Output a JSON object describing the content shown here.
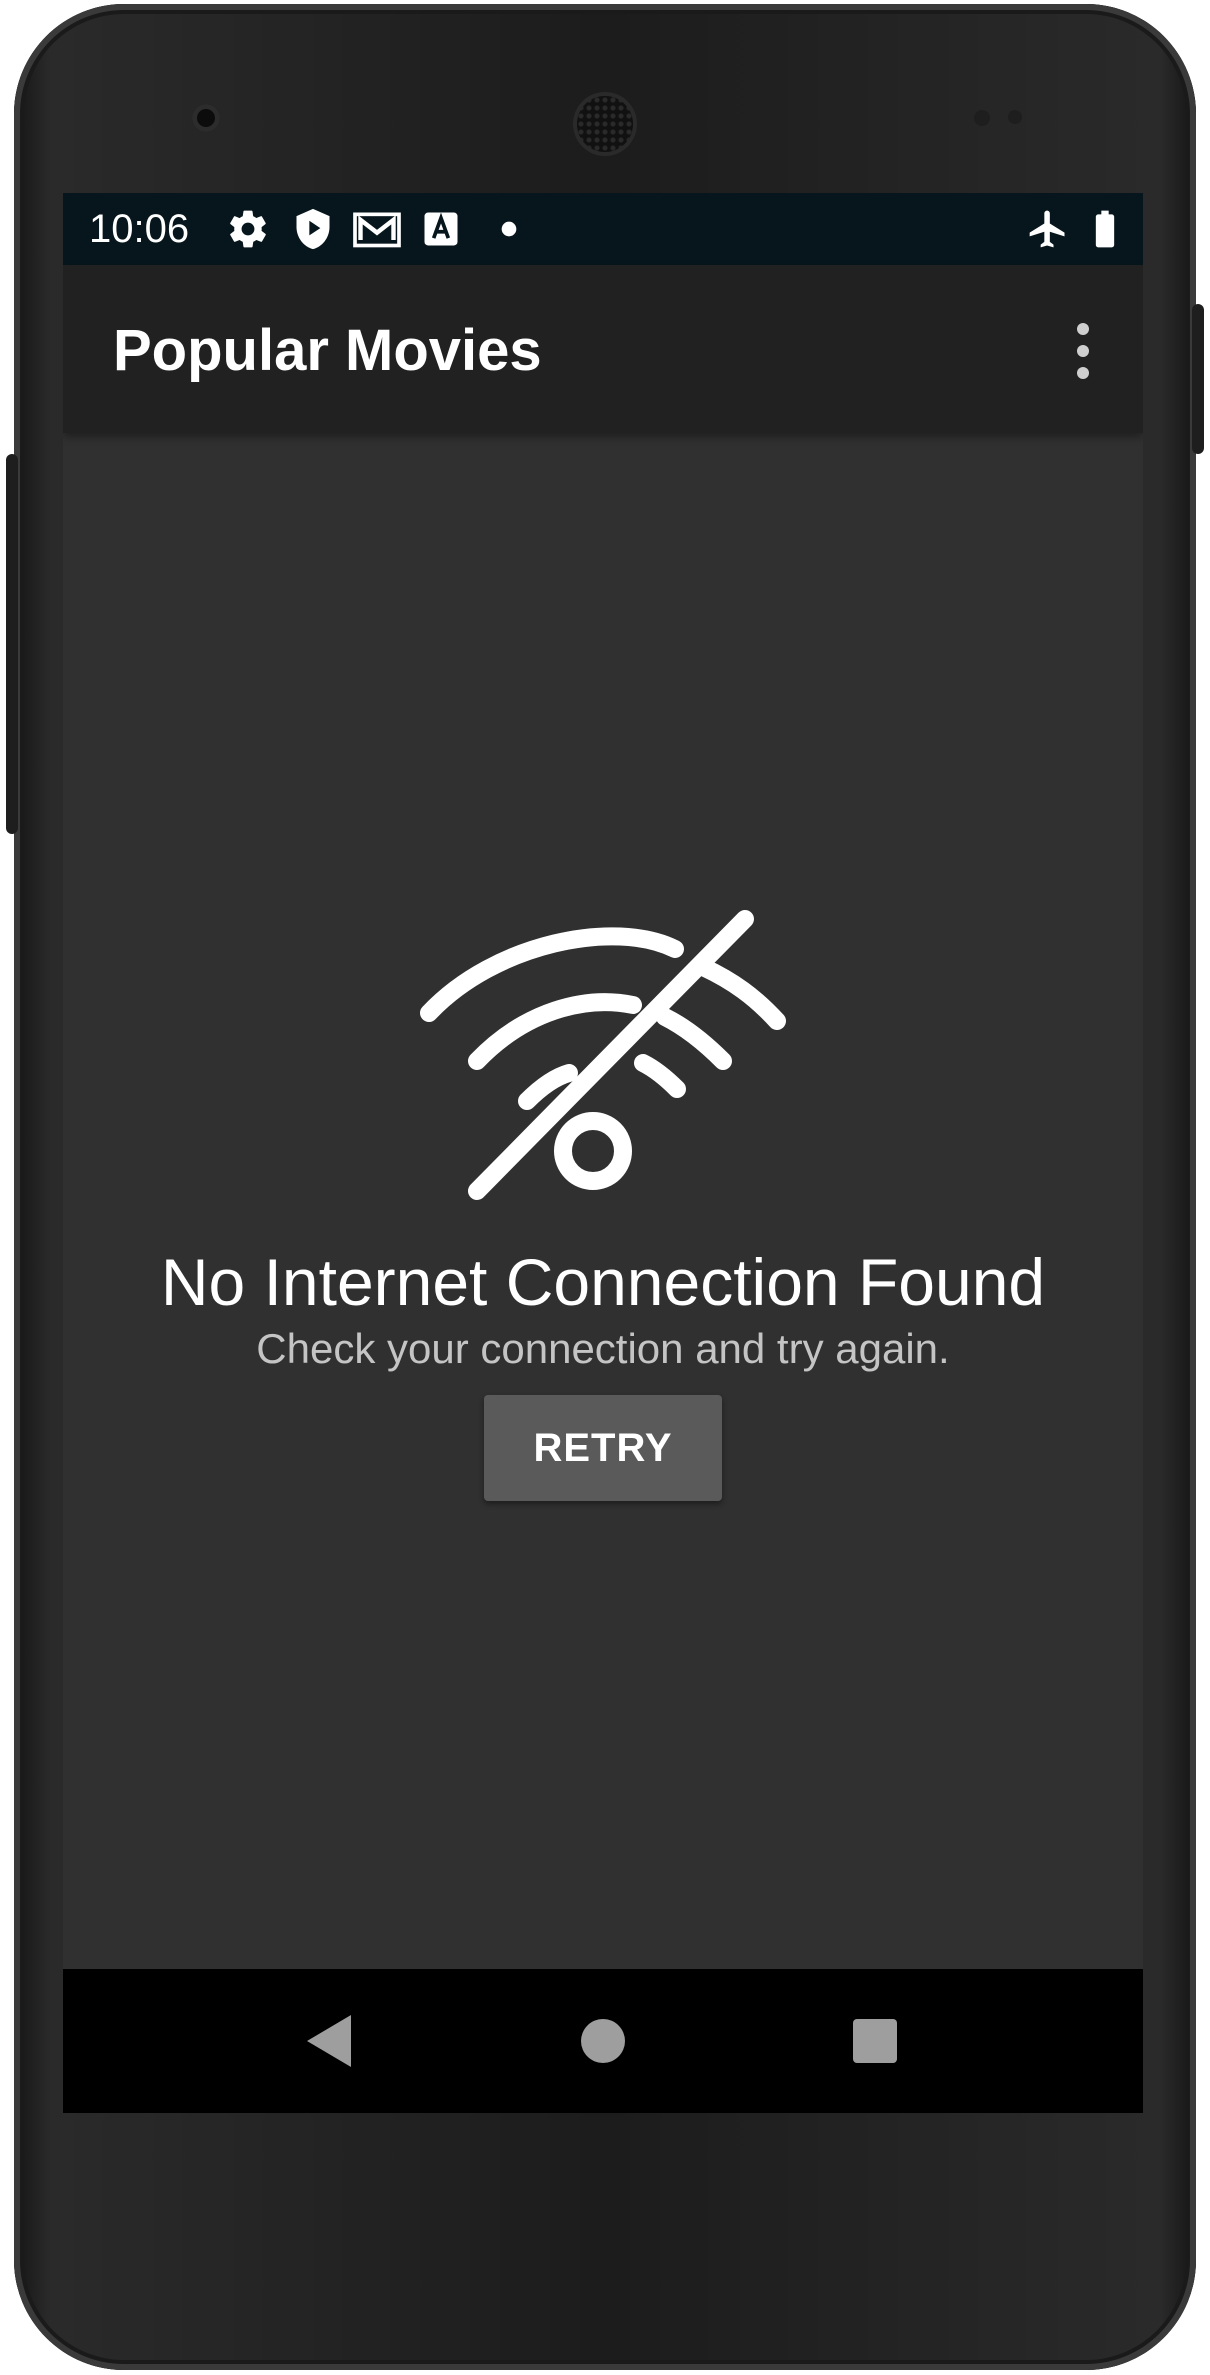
{
  "status_bar": {
    "time": "10:06",
    "icons_left": [
      "gear-icon",
      "shield-play-icon",
      "gmail-icon",
      "font-a-icon",
      "dot-icon"
    ],
    "icons_right": [
      "airplane-mode-icon",
      "battery-icon"
    ]
  },
  "app_bar": {
    "title": "Popular Movies",
    "overflow_icon": "more-vert-icon"
  },
  "error_state": {
    "icon": "wifi-off-icon",
    "title": "No Internet Connection Found",
    "subtitle": "Check your connection and try again.",
    "retry_label": "RETRY"
  },
  "nav_bar": {
    "buttons": [
      "back-icon",
      "home-icon",
      "recents-icon"
    ]
  },
  "colors": {
    "status_bar": "#07161c",
    "app_bar": "#212121",
    "background": "#303030",
    "button": "#5a5a5a",
    "text_primary": "#ffffff",
    "text_secondary": "#c4c4c4"
  }
}
